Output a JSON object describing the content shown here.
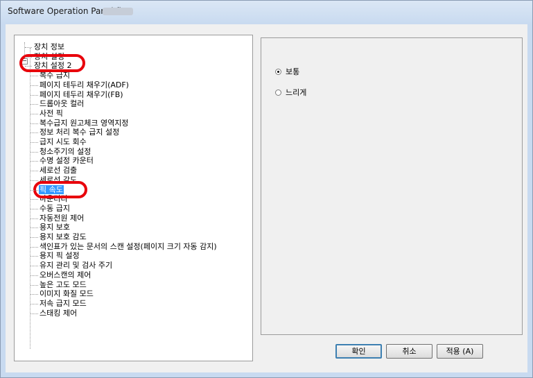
{
  "window": {
    "title": "Software Operation Panel fi-"
  },
  "tree": {
    "items": [
      "장치 정보",
      "장치 설정",
      "장치 설정 2",
      "복수 급지",
      "페이지 테두리 채우기(ADF)",
      "페이지 테두리 채우기(FB)",
      "드롭아웃 컬러",
      "사전 픽",
      "복수급지 원고체크 영역지정",
      "정보 처리 복수 급지 설정",
      "급지 시도 회수",
      "청소주기의 설정",
      "수명 설정 카운터",
      "세로선 검출",
      "세로선 감도",
      "픽 속도",
      "마운터리",
      "수동 급지",
      "자동전원 제어",
      "용지 보호",
      "용지 보호 감도",
      "색인표가 있는 문서의 스캔 설정(페이지 크기 자동 감지)",
      "용지 픽 설정",
      "유지 관리 및 검사 주기",
      "오버스캔의 제어",
      "높은 고도 모드",
      "이미지 화질 모드",
      "저속 급지 모드",
      "스태킹 제어"
    ],
    "selected_index": 15,
    "expander_symbol": "−"
  },
  "options": {
    "normal": "보통",
    "slow": "느리게",
    "selected": "normal"
  },
  "buttons": {
    "ok": "확인",
    "cancel": "취소",
    "apply": "적용 (A)"
  },
  "colors": {
    "highlight_oval": "#e8000b",
    "selection": "#3399ff",
    "titlebar": "#c8daf0"
  }
}
